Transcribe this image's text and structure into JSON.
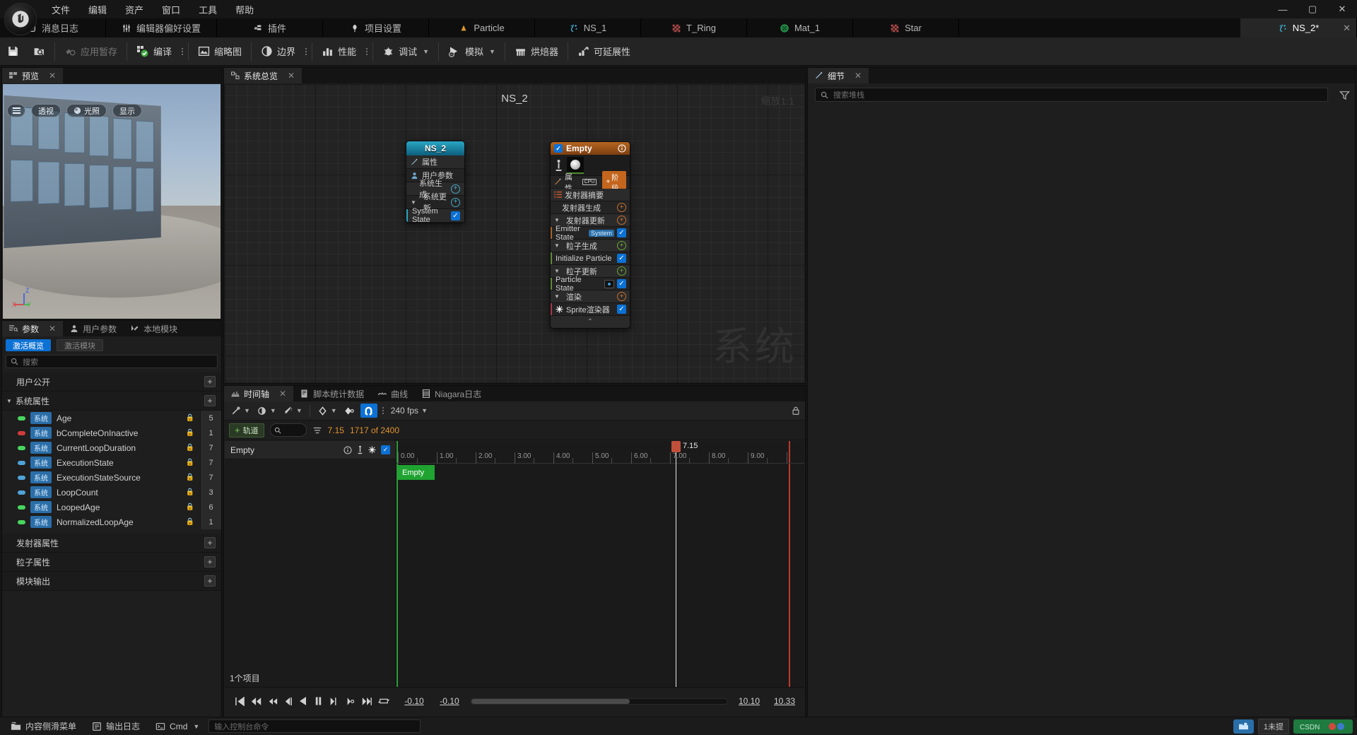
{
  "window": {
    "minimize": "—",
    "maximize": "▢",
    "close": "✕"
  },
  "menubar": {
    "items": [
      "文件",
      "编辑",
      "资产",
      "窗口",
      "工具",
      "帮助"
    ]
  },
  "tabs": [
    {
      "label": "消息日志",
      "icon": "message-log-icon",
      "active": false
    },
    {
      "label": "编辑器偏好设置",
      "icon": "preferences-icon",
      "active": false
    },
    {
      "label": "插件",
      "icon": "plugin-icon",
      "active": false
    },
    {
      "label": "项目设置",
      "icon": "project-settings-icon",
      "active": false
    },
    {
      "label": "Particle",
      "icon": "particle-icon",
      "active": false
    },
    {
      "label": "NS_1",
      "icon": "niagara-system-icon",
      "active": false
    },
    {
      "label": "T_Ring",
      "icon": "texture-icon",
      "active": false
    },
    {
      "label": "Mat_1",
      "icon": "material-icon",
      "active": false
    },
    {
      "label": "Star",
      "icon": "texture-icon",
      "active": false
    },
    {
      "label": "NS_2*",
      "icon": "niagara-system-icon",
      "active": true,
      "close": "✕"
    }
  ],
  "toolbar": {
    "save": "save-icon",
    "browse": "browse-icon",
    "apply_label": "应用暂存",
    "compile_label": "编译",
    "thumbnail_label": "缩略图",
    "bounds_label": "边界",
    "performance_label": "性能",
    "debug_label": "调试",
    "simulate_label": "模拟",
    "baker_label": "烘焙器",
    "scalability_label": "可延展性"
  },
  "viewport": {
    "tab_label": "预览",
    "tab_close": "✕",
    "buttons": [
      {
        "label": "",
        "name": "viewport-menu-button"
      },
      {
        "label": "透视",
        "name": "viewport-perspective-button"
      },
      {
        "label": "光照",
        "name": "viewport-lit-button"
      },
      {
        "label": "显示",
        "name": "viewport-show-button"
      }
    ],
    "gizmo": {
      "x": "X",
      "y": "Y",
      "z": "Z"
    }
  },
  "parameters": {
    "tabs": [
      {
        "label": "参数",
        "close": "✕",
        "active": true
      },
      {
        "label": "用户参数",
        "active": false
      },
      {
        "label": "本地模块",
        "active": false
      }
    ],
    "pills": [
      {
        "label": "激活概览",
        "on": true
      },
      {
        "label": "激活模块",
        "on": false
      }
    ],
    "search_placeholder": "搜索",
    "sections": [
      {
        "label": "用户公开",
        "expandable": false,
        "add": "+"
      },
      {
        "label": "系统属性",
        "expandable": true,
        "add": "+"
      }
    ],
    "rows": [
      {
        "dot": "#46d65e",
        "badge": "系统",
        "name": "Age",
        "lock": true,
        "value": "5"
      },
      {
        "dot": "#cf3b3b",
        "badge": "系统",
        "name": "bCompleteOnInactive",
        "lock": true,
        "value": "1"
      },
      {
        "dot": "#46d65e",
        "badge": "系统",
        "name": "CurrentLoopDuration",
        "lock": true,
        "value": "7"
      },
      {
        "dot": "#4fa3d8",
        "badge": "系统",
        "name": "ExecutionState",
        "lock": true,
        "value": "7"
      },
      {
        "dot": "#4fa3d8",
        "badge": "系统",
        "name": "ExecutionStateSource",
        "lock": true,
        "value": "7"
      },
      {
        "dot": "#4fa3d8",
        "badge": "系统",
        "name": "LoopCount",
        "lock": true,
        "value": "3"
      },
      {
        "dot": "#46d65e",
        "badge": "系统",
        "name": "LoopedAge",
        "lock": true,
        "value": "6"
      },
      {
        "dot": "#46d65e",
        "badge": "系统",
        "name": "NormalizedLoopAge",
        "lock": true,
        "value": "1"
      }
    ],
    "footer_sections": [
      {
        "label": "发射器属性",
        "add": "+"
      },
      {
        "label": "粒子属性",
        "add": "+"
      },
      {
        "label": "模块输出",
        "add": "+"
      }
    ]
  },
  "graph": {
    "tab_label": "系统总览",
    "tab_close": "✕",
    "title": "NS_2",
    "zoom_label": "缩放1:1",
    "watermark": "系统",
    "system_node": {
      "title": "NS_2",
      "rows": [
        {
          "label": "属性",
          "icon": "properties-icon",
          "type": "icon"
        },
        {
          "label": "用户参数",
          "icon": "user-icon",
          "type": "icon"
        },
        {
          "label": "系统生成",
          "type": "add",
          "plus": "+"
        },
        {
          "label": "系统更新",
          "type": "add",
          "plus": "+",
          "expanded": true
        },
        {
          "label": "System State",
          "type": "module",
          "checked": true
        }
      ]
    },
    "emitter_node": {
      "title": "Empty",
      "enabled": true,
      "info_icon": "info-icon",
      "cpu_label": "CPU",
      "properties_label": "属性",
      "stage_label": "阶段",
      "stage_plus": "+",
      "rows": [
        {
          "label": "发射器摘要",
          "type": "summary"
        },
        {
          "label": "发射器生成",
          "type": "add",
          "plus": "+",
          "accent": "orange"
        },
        {
          "label": "发射器更新",
          "type": "add",
          "plus": "+",
          "accent": "orange",
          "expanded": true
        },
        {
          "label": "Emitter State",
          "type": "module",
          "badge": "System",
          "checked": true,
          "stripe": "#a3632b"
        },
        {
          "label": "粒子生成",
          "type": "add",
          "plus": "+",
          "accent": "green",
          "expanded": true
        },
        {
          "label": "Initialize Particle",
          "type": "module",
          "checked": true,
          "stripe": "#5d8a37"
        },
        {
          "label": "粒子更新",
          "type": "add",
          "plus": "+",
          "accent": "green",
          "expanded": true
        },
        {
          "label": "Particle State",
          "type": "module",
          "badgeDot": true,
          "checked": true,
          "stripe": "#5d8a37"
        },
        {
          "label": "渲染",
          "type": "add",
          "plus": "+",
          "accent": "orange",
          "expanded": true
        },
        {
          "label": "Sprite渲染器",
          "type": "module",
          "icon": "sprite-icon",
          "checked": true,
          "stripe": "#a33b4b"
        }
      ],
      "collapse": "⌃"
    }
  },
  "details": {
    "tab_label": "细节",
    "tab_close": "✕",
    "search_placeholder": "搜索堆栈",
    "filter_icon": "filter-icon"
  },
  "timeline": {
    "tabs": [
      {
        "label": "时间轴",
        "close": "✕",
        "active": true
      },
      {
        "label": "脚本统计数据",
        "active": false
      },
      {
        "label": "曲线",
        "active": false
      },
      {
        "label": "Niagara日志",
        "active": false
      }
    ],
    "toolbar": {
      "fps_label": "240 fps",
      "snap_on": true,
      "lock_icon": "lock-icon"
    },
    "subbar": {
      "track_button": "轨道",
      "track_plus": "+",
      "search_placeholder": "",
      "time_value": "7.15",
      "frame_value": "1717 of 2400"
    },
    "tracks": [
      {
        "name": "Empty",
        "clip_label": "Empty",
        "checked": true
      }
    ],
    "item_count": "1个项目",
    "ruler_ticks": [
      "0.00",
      "1.00",
      "2.00",
      "3.00",
      "4.00",
      "5.00",
      "6.00",
      "7.00",
      "8.00",
      "9.00"
    ],
    "playhead_label": "7.15",
    "scrub": {
      "left1": "-0.10",
      "left2": "-0.10",
      "right1": "10.10",
      "right2": "10.33"
    }
  },
  "statusbar": {
    "content_drawer": "内容侧滑菜单",
    "output_log": "输出日志",
    "cmd_label": "Cmd",
    "cmd_placeholder": "输入控制台命令",
    "revision_badge": "1未提",
    "chips": [
      {
        "label": "",
        "color": "#2a6ea8"
      },
      {
        "label": "",
        "color": "#1f7a3f"
      }
    ]
  }
}
